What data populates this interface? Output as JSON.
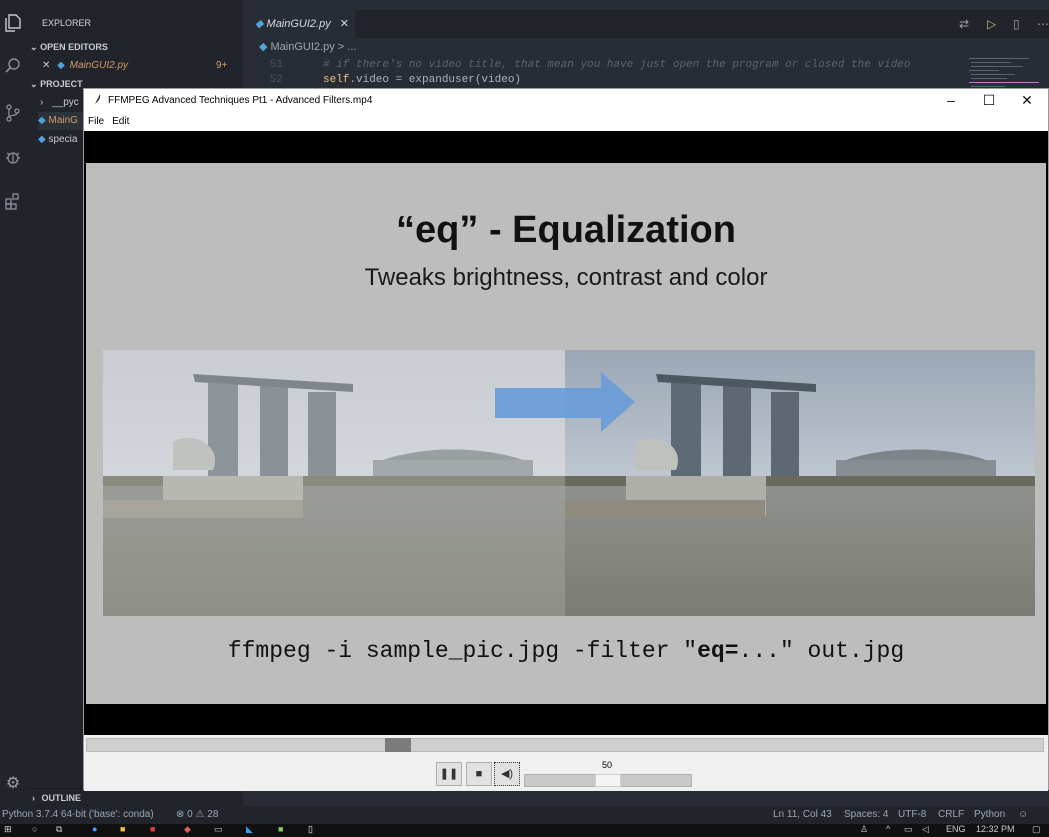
{
  "vscode": {
    "sidebar": {
      "explorer_label": "EXPLORER",
      "open_editors_label": "OPEN EDITORS",
      "open_editor_file": "MainGUI2.py",
      "open_editor_badge": "9+",
      "project_label": "PROJECT",
      "project_items": [
        "__pyc",
        "MainG",
        "specia"
      ],
      "outline_label": "OUTLINE"
    },
    "tab": {
      "label": "MainGUI2.py"
    },
    "breadcrumb": "MainGUI2.py > ...",
    "code": [
      {
        "line": "51",
        "text": "# if there's no video title, that mean you have just open the program or closed the video"
      },
      {
        "line": "52",
        "text_kw": "self",
        "text_rest": ".video = expanduser(video)"
      }
    ],
    "status": {
      "interpreter": "Python 3.7.4 64-bit ('base': conda)",
      "errors": "0",
      "warnings": "28",
      "position": "Ln 11, Col 43",
      "spaces": "Spaces: 4",
      "encoding": "UTF-8",
      "eol": "CRLF",
      "language": "Python"
    },
    "taskbar": {
      "language": "ENG",
      "time": "12:32 PM"
    }
  },
  "player": {
    "window_title": "FFMPEG Advanced Techniques Pt1 - Advanced Filters.mp4",
    "menu": [
      "File",
      "Edit"
    ],
    "slide": {
      "title": "“eq” - Equalization",
      "subtitle": "Tweaks brightness, contrast and color",
      "command_pre": "ffmpeg -i sample_pic.jpg -filter \"",
      "command_bold": "eq=",
      "command_post": "...\" out.jpg"
    },
    "seek_position": 0.32,
    "volume": 50,
    "volume_max": 100,
    "volume_label": "50",
    "icons": {
      "pause": "pause-icon",
      "stop": "stop-icon",
      "volume": "volume-icon"
    }
  }
}
